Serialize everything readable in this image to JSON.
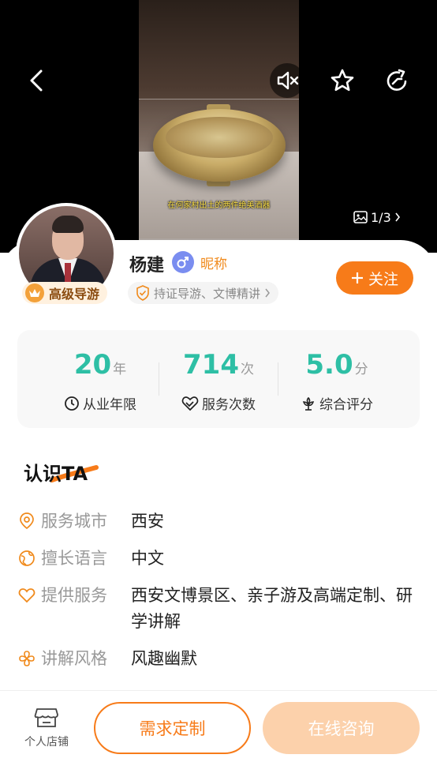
{
  "video": {
    "caption": "在何家村出土的两件绝美酒器",
    "counter": "1/3"
  },
  "profile": {
    "name": "杨建",
    "nickname": "昵称",
    "level": "高级导游",
    "tags": "持证导游、文博精讲",
    "follow_label": "关注"
  },
  "stats": [
    {
      "value": "20",
      "unit": "年",
      "label": "从业年限",
      "icon": "clock-icon"
    },
    {
      "value": "714",
      "unit": "次",
      "label": "服务次数",
      "icon": "handshake-heart-icon"
    },
    {
      "value": "5.0",
      "unit": "分",
      "label": "综合评分",
      "icon": "flower-icon"
    }
  ],
  "about": {
    "title_prefix": "认识",
    "title_suffix": "TA",
    "rows": [
      {
        "key": "服务城市",
        "value": "西安",
        "icon": "location-pin-icon"
      },
      {
        "key": "擅长语言",
        "value": "中文",
        "icon": "globe-icon"
      },
      {
        "key": "提供服务",
        "value": "西安文博景区、亲子游及高端定制、研学讲解",
        "icon": "heart-icon"
      },
      {
        "key": "讲解风格",
        "value": "风趣幽默",
        "icon": "clover-icon"
      }
    ]
  },
  "bottom_bar": {
    "store_label": "个人店铺",
    "custom_label": "需求定制",
    "consult_label": "在线咨询"
  },
  "colors": {
    "accent": "#f77b19",
    "teal": "#2ebfa5",
    "gender": "#7a8df0"
  }
}
